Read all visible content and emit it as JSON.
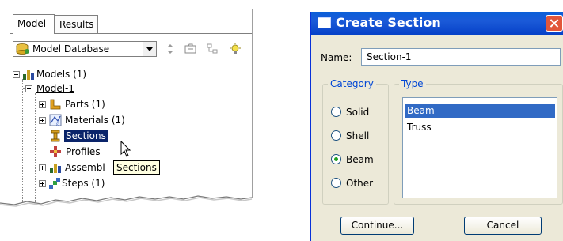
{
  "tree_panel": {
    "tabs": [
      {
        "label": "Model",
        "active": true
      },
      {
        "label": "Results",
        "active": false
      }
    ],
    "database_select": {
      "value": "Model Database"
    },
    "toolbar_icons": [
      "expand-collapse-icon",
      "folder-icon",
      "filter-icon",
      "lightbulb-icon"
    ],
    "nodes": {
      "models": "Models (1)",
      "model1": "Model-1",
      "parts": "Parts (1)",
      "materials": "Materials (1)",
      "sections": "Sections",
      "profiles": "Profiles",
      "assembly": "Assembl",
      "steps": "Steps (1)"
    },
    "tooltip": "Sections"
  },
  "dialog": {
    "title": "Create Section",
    "name_label": "Name:",
    "name_value": "Section-1",
    "category_title": "Category",
    "categories": [
      {
        "label": "Solid",
        "selected": false
      },
      {
        "label": "Shell",
        "selected": false
      },
      {
        "label": "Beam",
        "selected": true
      },
      {
        "label": "Other",
        "selected": false
      }
    ],
    "type_title": "Type",
    "types": [
      {
        "label": "Beam",
        "selected": true
      },
      {
        "label": "Truss",
        "selected": false
      }
    ],
    "continue_label": "Continue...",
    "cancel_label": "Cancel"
  },
  "colors": {
    "titlebar": "#0a5fd8",
    "selection": "#316ac5",
    "group_title": "#0046d5",
    "dialog_bg": "#ece9d8"
  }
}
